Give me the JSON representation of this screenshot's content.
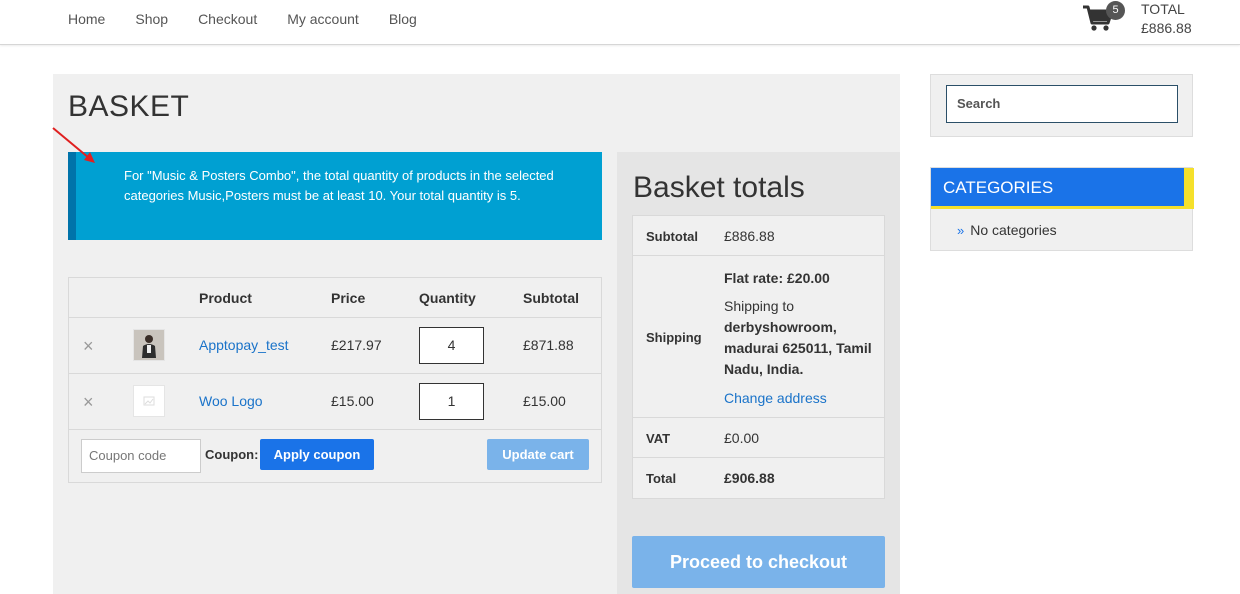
{
  "nav": {
    "items": [
      "Home",
      "Shop",
      "Checkout",
      "My account",
      "Blog"
    ]
  },
  "cart": {
    "count": "5",
    "total_label": "TOTAL",
    "total_amount": "£886.88"
  },
  "page": {
    "title": "BASKET"
  },
  "notice": {
    "text": "For \"Music & Posters Combo\", the total quantity of products in the selected categories Music,Posters must be at least 10. Your total quantity is 5."
  },
  "cart_table": {
    "headers": {
      "product": "Product",
      "price": "Price",
      "quantity": "Quantity",
      "subtotal": "Subtotal"
    },
    "rows": [
      {
        "remove": "×",
        "name": "Apptopay_test",
        "price": "£217.97",
        "quantity": "4",
        "subtotal": "£871.88"
      },
      {
        "remove": "×",
        "name": "Woo Logo",
        "price": "£15.00",
        "quantity": "1",
        "subtotal": "£15.00"
      }
    ],
    "coupon_placeholder": "Coupon code",
    "coupon_label": "Coupon:",
    "apply_label": "Apply coupon",
    "update_label": "Update cart"
  },
  "totals": {
    "title": "Basket totals",
    "subtotal_label": "Subtotal",
    "subtotal_value": "£886.88",
    "shipping_label": "Shipping",
    "shipping_rate": "Flat rate: £20.00",
    "shipping_to": "Shipping to",
    "shipping_address": "derbyshowroom, madurai 625011, Tamil Nadu, India.",
    "change_address": "Change address",
    "vat_label": "VAT",
    "vat_value": "£0.00",
    "total_label": "Total",
    "total_value": "£906.88",
    "checkout_label": "Proceed to checkout"
  },
  "sidebar": {
    "search_placeholder": "Search",
    "categories_title": "CATEGORIES",
    "categories_empty": "No categories"
  },
  "colors": {
    "accent_blue": "#1a73e8",
    "notice_bg": "#00a0d2",
    "category_stripe": "#f5e02b",
    "disabled_button": "#7ab3ea"
  }
}
